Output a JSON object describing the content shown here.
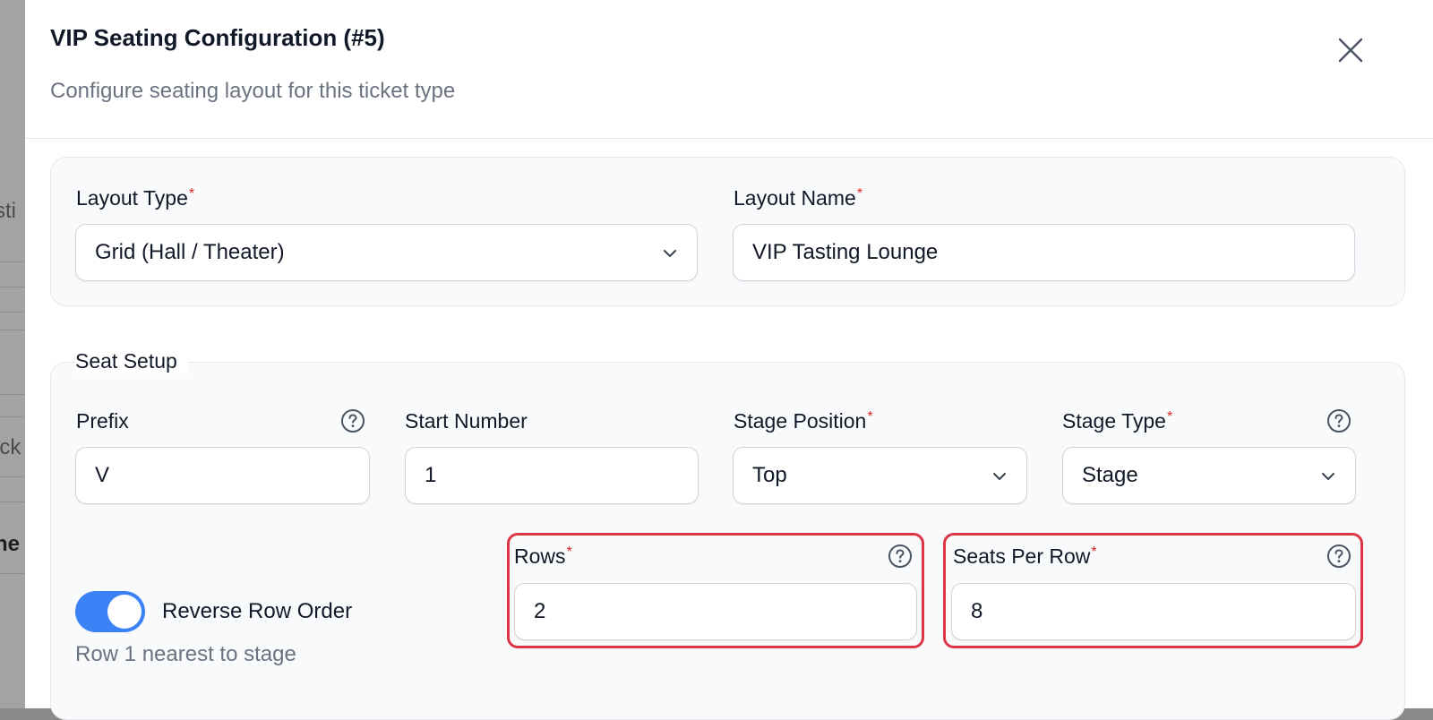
{
  "backdrop": {
    "fragments": [
      "sti",
      "ick",
      "ne"
    ]
  },
  "modal": {
    "title": "VIP Seating Configuration (#5)",
    "subtitle": "Configure seating layout for this ticket type",
    "close_icon": "close-icon"
  },
  "layout": {
    "type_label": "Layout Type",
    "type_value": "Grid (Hall / Theater)",
    "name_label": "Layout Name",
    "name_value": "VIP Tasting Lounge"
  },
  "seat_setup": {
    "legend": "Seat Setup",
    "prefix_label": "Prefix",
    "prefix_value": "V",
    "start_label": "Start Number",
    "start_value": "1",
    "stage_position_label": "Stage Position",
    "stage_position_value": "Top",
    "stage_type_label": "Stage Type",
    "stage_type_value": "Stage",
    "rows_label": "Rows",
    "rows_value": "2",
    "seats_label": "Seats Per Row",
    "seats_value": "8",
    "reverse_label": "Reverse Row Order",
    "reverse_enabled": true,
    "reverse_hint": "Row 1 nearest to stage"
  },
  "required_marker": "*",
  "colors": {
    "accent": "#3b82f6",
    "required": "#dc2626",
    "highlight": "#dc3545",
    "muted_text": "#6b7280"
  }
}
